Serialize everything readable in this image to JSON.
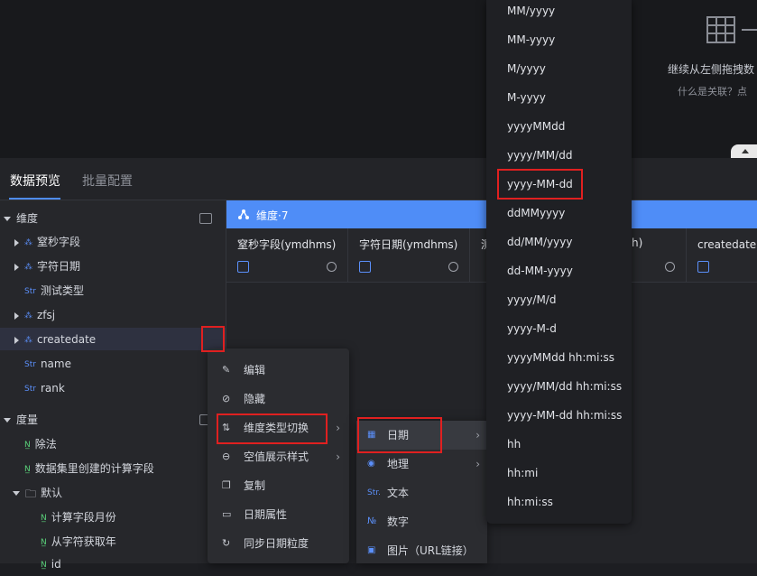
{
  "background_hint": {
    "line1": "继续从左侧拖拽数",
    "line2": "什么是关联？点"
  },
  "tabs": [
    {
      "label": "数据预览"
    },
    {
      "label": "批量配置"
    }
  ],
  "sidebar": {
    "dimension_group": "维度",
    "dimension_items": [
      {
        "label": "窒秒字段",
        "icon": "hierarchy-icon"
      },
      {
        "label": "字符日期",
        "icon": "hierarchy-icon"
      },
      {
        "label": "测试类型",
        "icon": "Str"
      },
      {
        "label": "zfsj",
        "icon": "hierarchy-icon"
      },
      {
        "label": "createdate",
        "icon": "hierarchy-icon"
      },
      {
        "label": "name",
        "icon": "Str"
      },
      {
        "label": "rank",
        "icon": "Str"
      }
    ],
    "measure_group": "度量",
    "measure_items": [
      {
        "label": "除法"
      },
      {
        "label": "数据集里创建的计算字段"
      }
    ],
    "folder": "默认",
    "folder_items": [
      {
        "label": "计算字段月份"
      },
      {
        "label": "从字符获取年"
      },
      {
        "label": "id"
      }
    ]
  },
  "table": {
    "dimension_bar": "维度·7",
    "columns": [
      {
        "title": "窒秒字段(ymdhms)"
      },
      {
        "title": "字符日期(ymdhms)"
      },
      {
        "title": "测"
      },
      {
        "title": "h)"
      },
      {
        "title": "createdate(日"
      }
    ]
  },
  "context_menu": {
    "items": [
      {
        "label": "编辑",
        "icon": "edit-icon"
      },
      {
        "label": "隐藏",
        "icon": "hide-icon"
      },
      {
        "label": "维度类型切换",
        "icon": "switch-icon",
        "has_submenu": true
      },
      {
        "label": "空值展示样式",
        "icon": "null-style-icon",
        "has_submenu": true
      },
      {
        "label": "复制",
        "icon": "copy-icon"
      },
      {
        "label": "日期属性",
        "icon": "calendar-icon"
      },
      {
        "label": "同步日期粒度",
        "icon": "sync-icon"
      }
    ]
  },
  "type_submenu": {
    "items": [
      {
        "label": "日期",
        "icon": "date-icon",
        "has_submenu": true
      },
      {
        "label": "地理",
        "icon": "geo-icon",
        "has_submenu": true
      },
      {
        "label": "文本",
        "icon": "Str"
      },
      {
        "label": "数字",
        "icon": "№"
      },
      {
        "label": "图片（URL链接）",
        "icon": "image-icon"
      }
    ]
  },
  "format_menu": {
    "items": [
      "MM/yyyy",
      "MM-yyyy",
      "M/yyyy",
      "M-yyyy",
      "yyyyMMdd",
      "yyyy/MM/dd",
      "yyyy-MM-dd",
      "ddMMyyyy",
      "dd/MM/yyyy",
      "dd-MM-yyyy",
      "yyyy/M/d",
      "yyyy-M-d",
      "yyyyMMdd hh:mi:ss",
      "yyyy/MM/dd hh:mi:ss",
      "yyyy-MM-dd hh:mi:ss",
      "hh",
      "hh:mi",
      "hh:mi:ss"
    ],
    "selected": "yyyy-MM-dd"
  },
  "colors": {
    "accent": "#4f8df7",
    "highlight_border": "#e02020"
  }
}
